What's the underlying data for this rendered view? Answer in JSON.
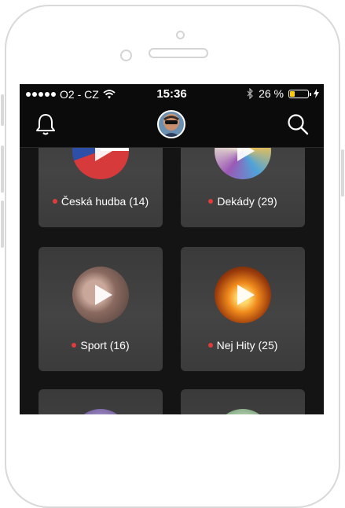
{
  "status_bar": {
    "carrier": "O2 - CZ",
    "time": "15:36",
    "battery_text": "26 %",
    "battery_level": 0.26,
    "battery_color": "#ffcc00"
  },
  "nav": {
    "left_icon": "bell-icon",
    "center": "avatar",
    "right_icon": "search-icon"
  },
  "accent_color": "#e23b3b",
  "categories": [
    {
      "label": "Česká hudba (14)"
    },
    {
      "label": "Dekády (29)"
    },
    {
      "label": "Sport (16)"
    },
    {
      "label": "Nej Hity (25)"
    },
    {
      "label": ""
    },
    {
      "label": ""
    }
  ]
}
